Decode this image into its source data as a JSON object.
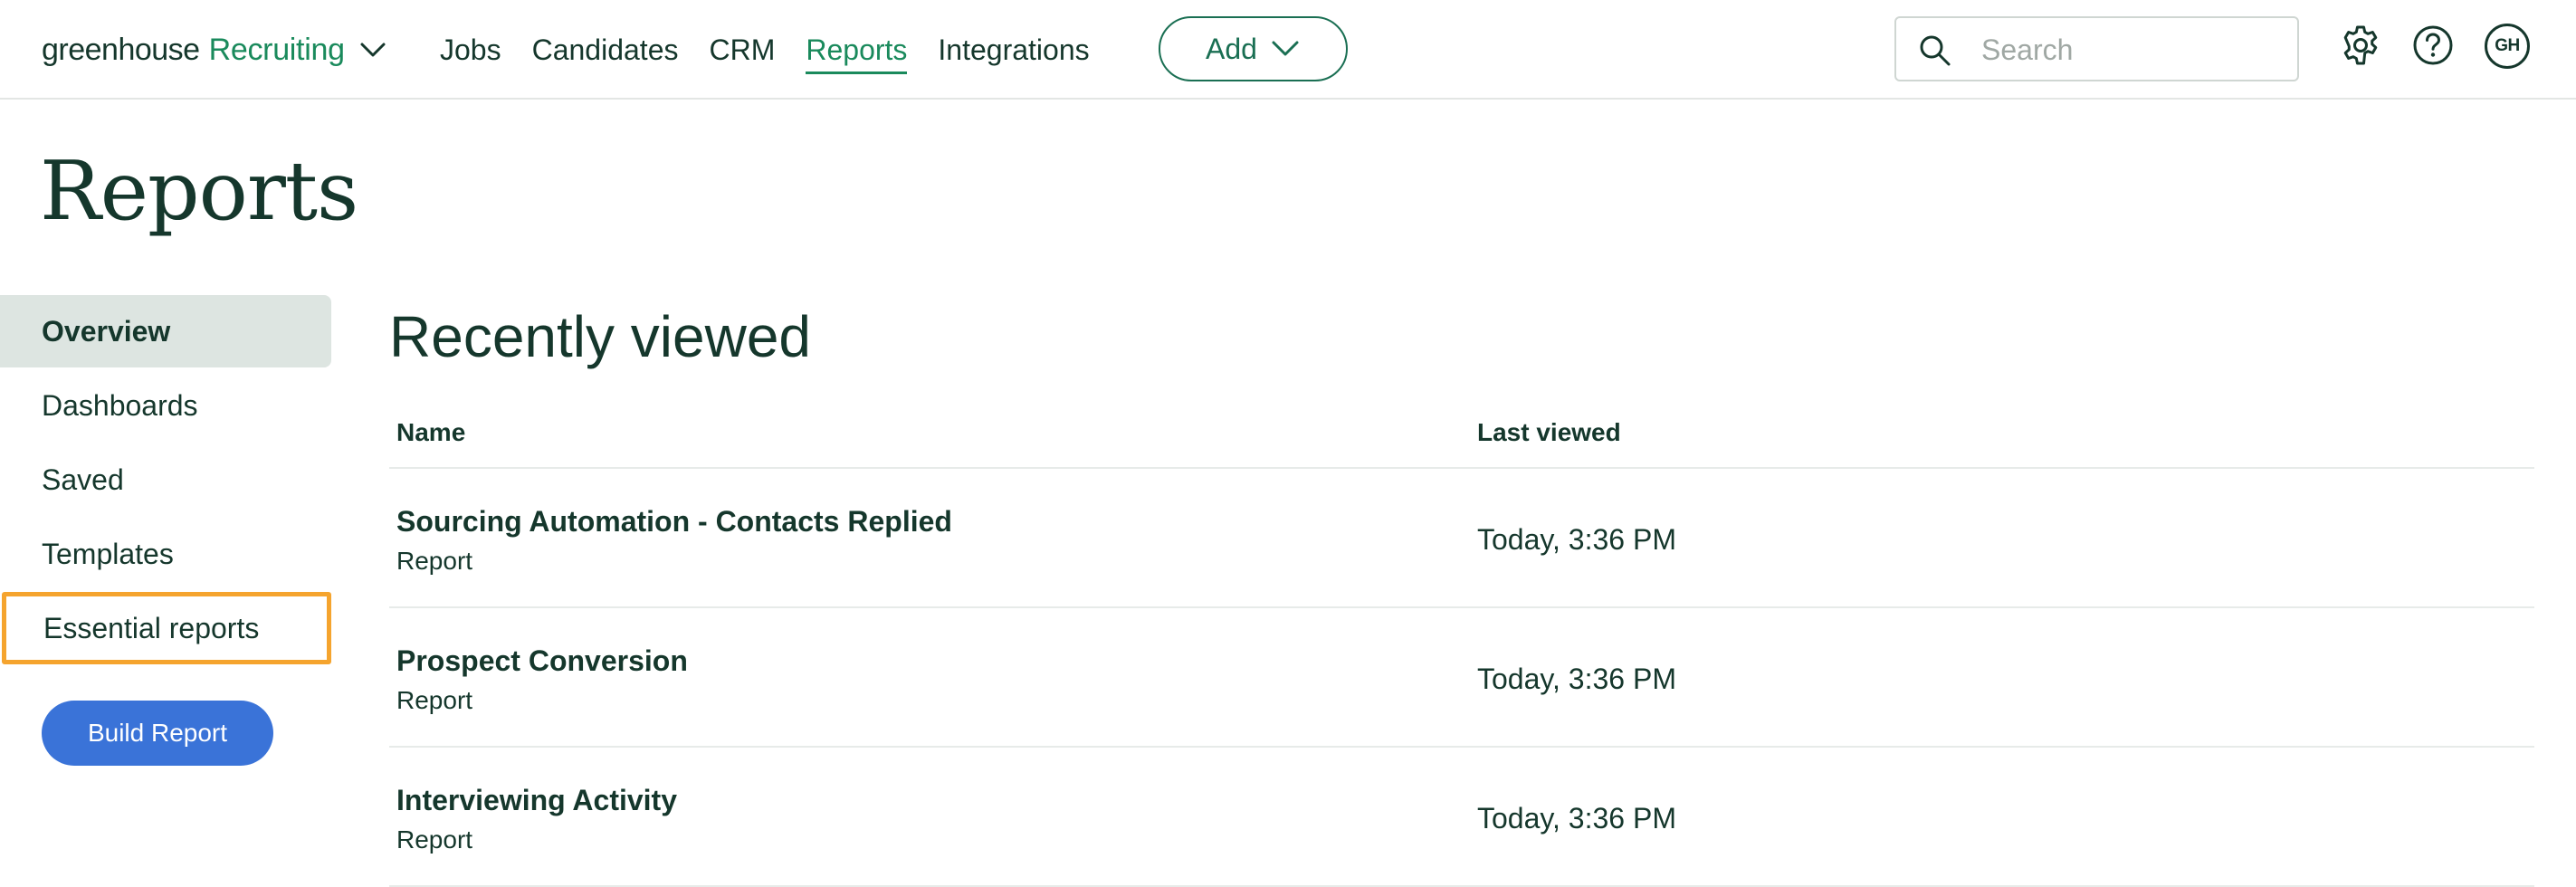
{
  "brand": {
    "main": "greenhouse",
    "sub": "Recruiting"
  },
  "nav": {
    "items": [
      {
        "label": "Jobs"
      },
      {
        "label": "Candidates"
      },
      {
        "label": "CRM"
      },
      {
        "label": "Reports"
      },
      {
        "label": "Integrations"
      }
    ],
    "active": "Reports",
    "add_label": "Add"
  },
  "search": {
    "placeholder": "Search"
  },
  "user": {
    "initials": "GH"
  },
  "page": {
    "title": "Reports"
  },
  "sidebar": {
    "items": [
      {
        "label": "Overview"
      },
      {
        "label": "Dashboards"
      },
      {
        "label": "Saved"
      },
      {
        "label": "Templates"
      },
      {
        "label": "Essential reports"
      }
    ],
    "build_label": "Build Report"
  },
  "recent": {
    "title": "Recently viewed",
    "columns": {
      "name": "Name",
      "last_viewed": "Last viewed"
    },
    "rows": [
      {
        "name": "Sourcing Automation - Contacts Replied",
        "type": "Report",
        "time": "Today, 3:36 PM"
      },
      {
        "name": "Prospect Conversion",
        "type": "Report",
        "time": "Today, 3:36 PM"
      },
      {
        "name": "Interviewing Activity",
        "type": "Report",
        "time": "Today, 3:36 PM"
      }
    ]
  },
  "colors": {
    "brand_green": "#1a8a5c",
    "text_dark": "#15372c",
    "primary_blue": "#3a73d8",
    "highlight_orange": "#f5a42e",
    "active_bg": "#dde5e1"
  },
  "icons": {
    "brand_dropdown": "chevron-down-icon",
    "search": "search-icon",
    "settings": "gear-icon",
    "help": "help-icon"
  }
}
